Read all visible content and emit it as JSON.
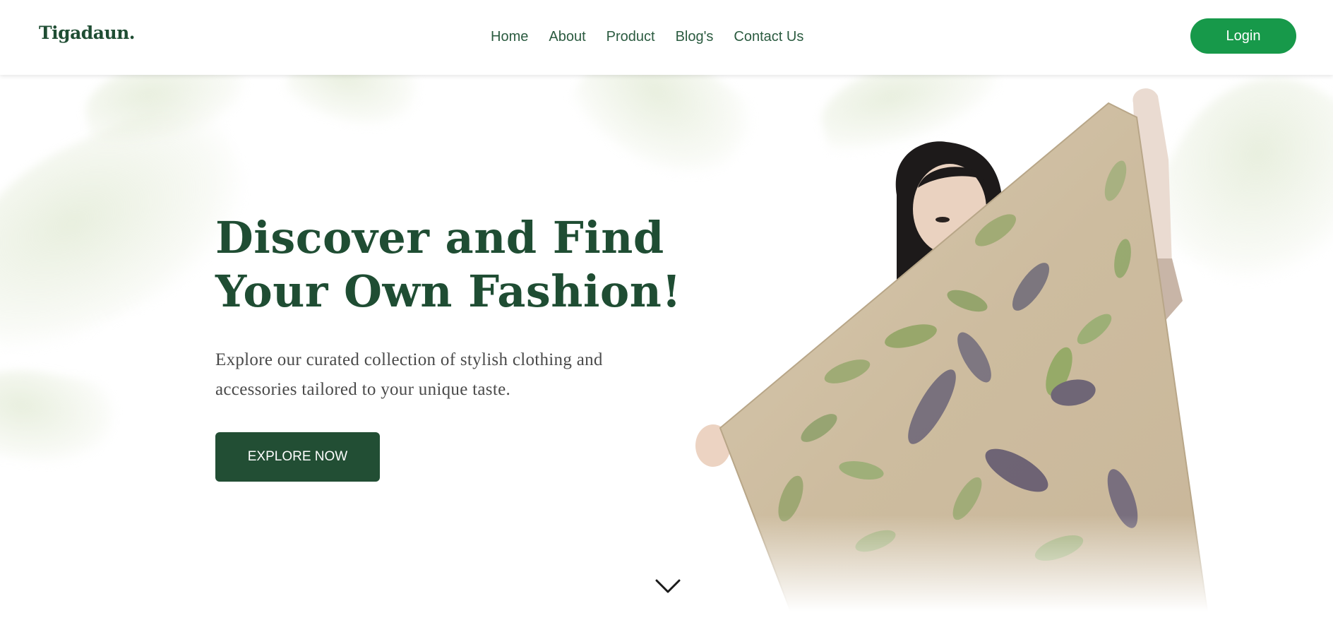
{
  "header": {
    "logo": "Tigadaun.",
    "nav": [
      "Home",
      "About",
      "Product",
      "Blog's",
      "Contact Us"
    ],
    "login_label": "Login"
  },
  "hero": {
    "headline": "Discover and Find\nYour Own Fashion!",
    "subtext": "Explore our curated collection of stylish clothing and accessories tailored to your unique taste.",
    "cta_label": "EXPLORE NOW",
    "scroll_icon": "chevron-down-icon",
    "image": "woman-holding-leaf-print-scarf"
  },
  "colors": {
    "brand_dark_green": "#224e34",
    "heading_green": "#1f4d33",
    "login_green": "#17994a",
    "nav_text": "#2b5b40",
    "body_text": "#4a4a4a"
  }
}
